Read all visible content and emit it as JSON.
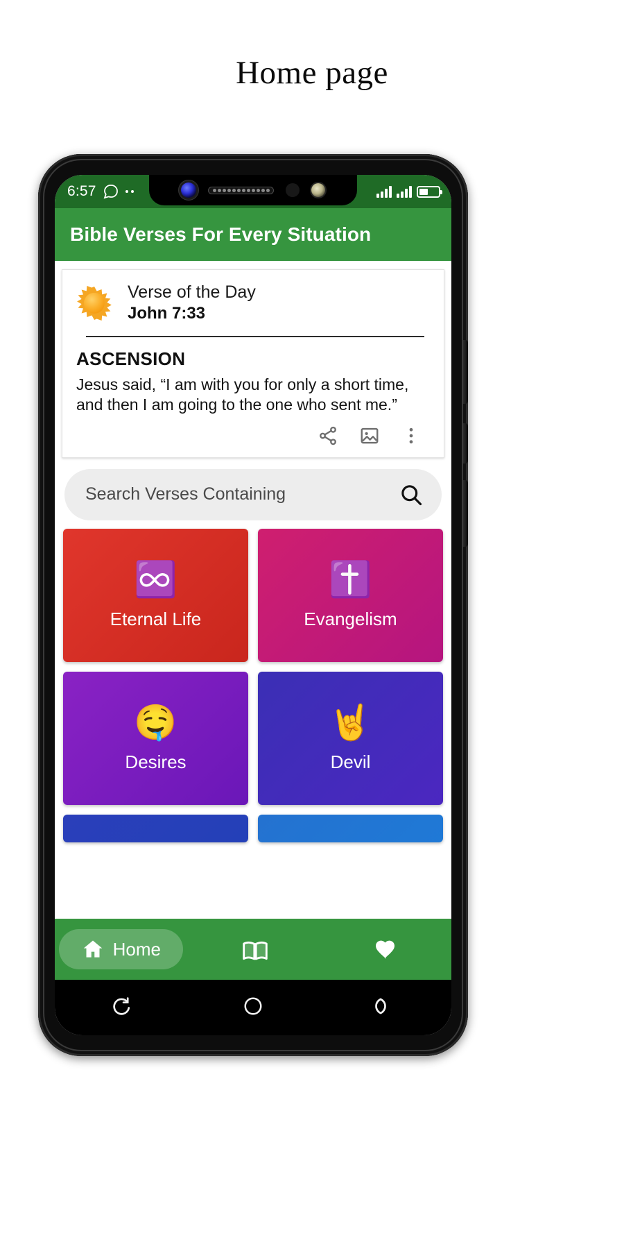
{
  "page": {
    "title": "Home page"
  },
  "status_bar": {
    "time": "6:57",
    "icons": [
      "chat-bubble-icon",
      "more-dots-icon"
    ],
    "right_icons": [
      "signal-bars-icon",
      "signal-bars-icon",
      "battery-icon"
    ],
    "bg_color": "#1f6b26"
  },
  "app_bar": {
    "title": "Bible Verses For Every Situation",
    "bg_color": "#36953f",
    "text_color": "#ffffff"
  },
  "verse_card": {
    "emoji": "☀️",
    "label": "Verse of the Day",
    "reference": "John 7:33",
    "title": "ASCENSION",
    "text": "Jesus said, “I am with you for only a short time, and then I am going to the one who sent me.”",
    "actions": [
      {
        "name": "share-icon"
      },
      {
        "name": "image-icon"
      },
      {
        "name": "more-vert-icon"
      }
    ]
  },
  "search": {
    "placeholder": "Search Verses Containing",
    "icon": "search-icon",
    "bg_color": "#ededed"
  },
  "tiles": [
    {
      "label": "Eternal Life",
      "glyph": "♾️",
      "icon_name": "infinity-icon",
      "color_from": "#e0362c",
      "color_to": "#c9261d"
    },
    {
      "label": "Evangelism",
      "glyph": "✝️",
      "icon_name": "cross-icon",
      "color_from": "#cf1f6f",
      "color_to": "#b5157f"
    },
    {
      "label": "Desires",
      "glyph": "🤤",
      "icon_name": "drooling-face-icon",
      "color_from": "#8a22c4",
      "color_to": "#6a17b8"
    },
    {
      "label": "Devil",
      "glyph": "🤘",
      "icon_name": "horns-hand-icon",
      "color_from": "#3b2fb5",
      "color_to": "#4b27c0"
    },
    {
      "label": "",
      "glyph": "",
      "icon_name": "partial-tile",
      "color_from": "#2440b8",
      "color_to": "#2440b8"
    },
    {
      "label": "",
      "glyph": "",
      "icon_name": "partial-tile",
      "color_from": "#1f79d6",
      "color_to": "#1f79d6"
    }
  ],
  "bottom_nav": {
    "bg_color": "#36953f",
    "items": [
      {
        "label": "Home",
        "icon": "home-icon",
        "selected": true
      },
      {
        "label": "",
        "icon": "book-icon",
        "selected": false
      },
      {
        "label": "",
        "icon": "heart-icon",
        "selected": false
      }
    ]
  },
  "android_nav": {
    "items": [
      {
        "icon": "back-icon"
      },
      {
        "icon": "home-circle-icon"
      },
      {
        "icon": "recents-icon"
      }
    ]
  }
}
